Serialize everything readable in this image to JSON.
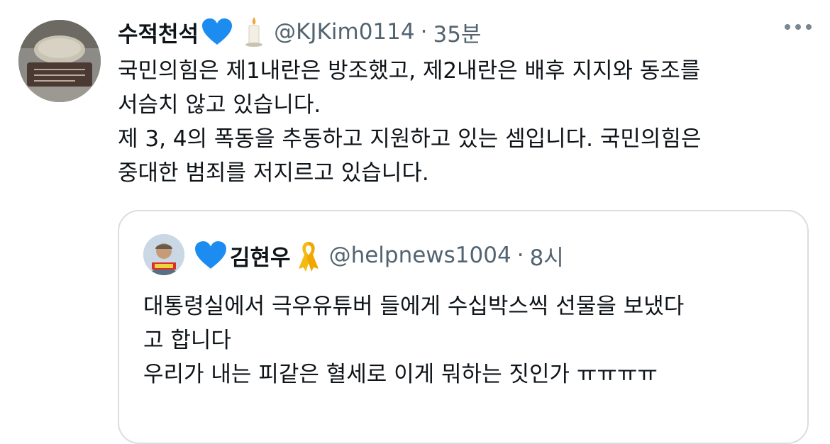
{
  "tweet": {
    "author_name": "수적천석",
    "author_handle": "@KJKim0114",
    "separator": "·",
    "time": "35분",
    "emoji": [
      "blue-heart",
      "candle"
    ],
    "lines": [
      "국민의힘은 제1내란은 방조했고, 제2내란은 배후 지지와 동조를",
      "서슴치 않고 있습니다.",
      "제 3, 4의 폭동을 추동하고 지원하고 있는 셈입니다. 국민의힘은",
      "중대한 범죄를 저지르고 있습니다."
    ]
  },
  "quoted_tweet": {
    "author_name": "김현우",
    "author_handle": "@helpnews1004",
    "separator": "·",
    "time": "8시",
    "emoji": [
      "blue-heart",
      "yellow-ribbon"
    ],
    "lines": [
      "대통령실에서 극우유튜버 들에게 수십박스씩 선물을 보냈다",
      "고 합니다",
      "우리가 내는 피같은 혈세로 이게 뭐하는 짓인가 ㅠㅠㅠㅠ"
    ]
  },
  "colors": {
    "text": "#0f1419",
    "secondary": "#536471",
    "border": "#d9dee2",
    "heart": "#1d8cf0",
    "ribbon": "#f5b914"
  }
}
